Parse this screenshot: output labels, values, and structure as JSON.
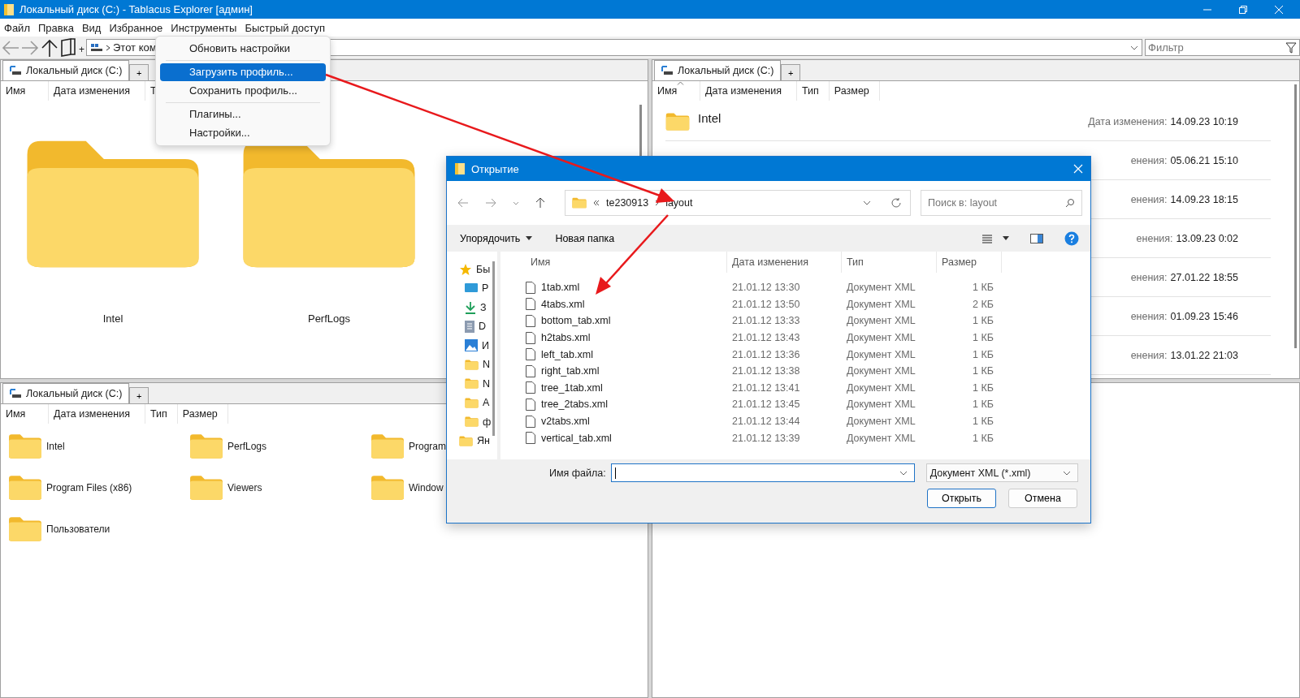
{
  "window": {
    "title": "Локальный диск (C:) - Tablacus Explorer [админ]"
  },
  "menu_bar": [
    "Файл",
    "Правка",
    "Вид",
    "Избранное",
    "Инструменты",
    "Быстрый доступ"
  ],
  "dropdown_menu": [
    {
      "kind": "item",
      "label": "Обновить настройки",
      "selected": false
    },
    {
      "kind": "separator"
    },
    {
      "kind": "item",
      "label": "Загрузить профиль...",
      "selected": true
    },
    {
      "kind": "item",
      "label": "Сохранить профиль...",
      "selected": false
    },
    {
      "kind": "separator"
    },
    {
      "kind": "item",
      "label": "Плагины...",
      "selected": false
    },
    {
      "kind": "item",
      "label": "Настройки...",
      "selected": false
    }
  ],
  "toolbar": {
    "new_tab": "+",
    "address": "Этот ком",
    "filter": {
      "placeholder": "Фильтр"
    }
  },
  "panes": [
    {
      "kind": "large",
      "tab": "Локальный диск (C:)",
      "new_tab": "+",
      "columns": [
        "Имя",
        "Дата изменения",
        "Т"
      ],
      "items": [
        {
          "name": "Intel"
        },
        {
          "name": "PerfLogs"
        }
      ]
    },
    {
      "kind": "tiles",
      "tab": "Локальный диск (C:)",
      "new_tab": "+",
      "columns": [
        "Имя",
        "Дата изменения",
        "Тип",
        "Размер"
      ],
      "items": [
        {
          "name": "Intel",
          "label": "Дата изменения:",
          "value": "14.09.23 10:19"
        },
        {
          "label": "енения:",
          "value": "05.06.21 15:10"
        },
        {
          "label": "енения:",
          "value": "14.09.23 18:15"
        },
        {
          "label": "енения:",
          "value": "13.09.23 0:02"
        },
        {
          "label": "енения:",
          "value": "27.01.22 18:55"
        },
        {
          "label": "енения:",
          "value": "01.09.23 15:46"
        },
        {
          "label": "енения:",
          "value": "13.01.22 21:03"
        }
      ]
    },
    {
      "kind": "medium",
      "tab": "Локальный диск (C:)",
      "new_tab": "+",
      "columns": [
        "Имя",
        "Дата изменения",
        "Тип",
        "Размер"
      ],
      "items": [
        {
          "name": "Intel"
        },
        {
          "name": "PerfLogs"
        },
        {
          "name": "Program"
        },
        {
          "name": "Program Files (x86)"
        },
        {
          "name": "Viewers"
        },
        {
          "name": "Window"
        },
        {
          "name": "Пользователи"
        }
      ]
    },
    {
      "kind": "empty"
    }
  ],
  "dialog": {
    "title": "Открытие",
    "breadcrumb": [
      "te230913",
      "layout"
    ],
    "search": {
      "placeholder": "Поиск в: layout"
    },
    "commands": [
      "Упорядочить",
      "Новая папка"
    ],
    "nav": [
      {
        "label": "Бы",
        "kind": "star",
        "children": [
          {
            "label": "Р",
            "kind": "desktop"
          },
          {
            "label": "З",
            "kind": "download"
          },
          {
            "label": "D",
            "kind": "document"
          },
          {
            "label": "И",
            "kind": "image"
          },
          {
            "label": "N",
            "kind": "folder"
          },
          {
            "label": "N",
            "kind": "folder"
          },
          {
            "label": "А",
            "kind": "folder"
          },
          {
            "label": "ф",
            "kind": "folder"
          }
        ]
      },
      {
        "label": "Ян",
        "kind": "folder"
      }
    ],
    "columns": [
      "Имя",
      "Дата изменения",
      "Тип",
      "Размер"
    ],
    "files": [
      {
        "name": "1tab.xml",
        "date": "21.01.12 13:30",
        "type": "Документ XML",
        "size": "1 КБ"
      },
      {
        "name": "4tabs.xml",
        "date": "21.01.12 13:50",
        "type": "Документ XML",
        "size": "2 КБ"
      },
      {
        "name": "bottom_tab.xml",
        "date": "21.01.12 13:33",
        "type": "Документ XML",
        "size": "1 КБ"
      },
      {
        "name": "h2tabs.xml",
        "date": "21.01.12 13:43",
        "type": "Документ XML",
        "size": "1 КБ"
      },
      {
        "name": "left_tab.xml",
        "date": "21.01.12 13:36",
        "type": "Документ XML",
        "size": "1 КБ"
      },
      {
        "name": "right_tab.xml",
        "date": "21.01.12 13:38",
        "type": "Документ XML",
        "size": "1 КБ"
      },
      {
        "name": "tree_1tab.xml",
        "date": "21.01.12 13:41",
        "type": "Документ XML",
        "size": "1 КБ"
      },
      {
        "name": "tree_2tabs.xml",
        "date": "21.01.12 13:45",
        "type": "Документ XML",
        "size": "1 КБ"
      },
      {
        "name": "v2tabs.xml",
        "date": "21.01.12 13:44",
        "type": "Документ XML",
        "size": "1 КБ"
      },
      {
        "name": "vertical_tab.xml",
        "date": "21.01.12 13:39",
        "type": "Документ XML",
        "size": "1 КБ"
      }
    ],
    "filename": {
      "label": "Имя файла:"
    },
    "file_type": "Документ XML (*.xml)",
    "buttons": [
      {
        "label": "Открыть",
        "default": true
      },
      {
        "label": "Отмена",
        "default": false
      }
    ]
  }
}
